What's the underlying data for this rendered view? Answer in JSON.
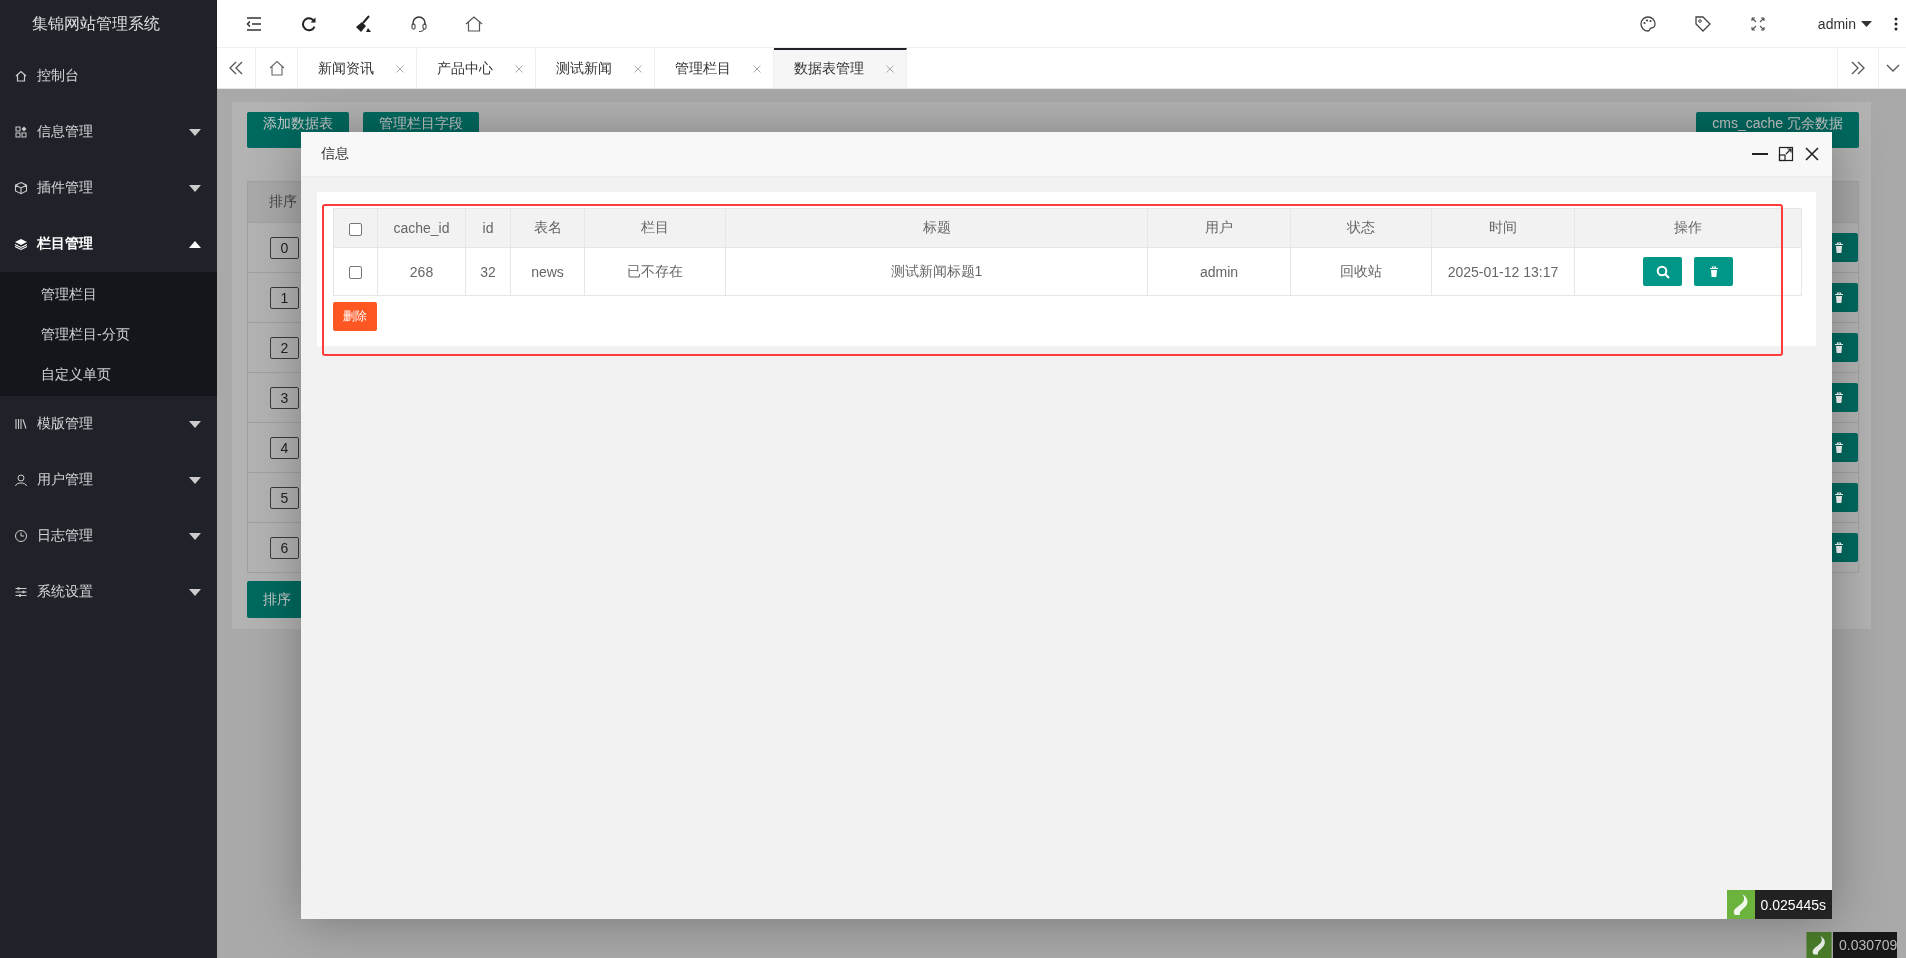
{
  "sidebar": {
    "title": "集锦网站管理系统",
    "items": [
      {
        "label": "控制台",
        "kind": "link"
      },
      {
        "label": "信息管理",
        "kind": "group",
        "expanded": false
      },
      {
        "label": "插件管理",
        "kind": "group",
        "expanded": false
      },
      {
        "label": "栏目管理",
        "kind": "group",
        "expanded": true,
        "children": [
          {
            "label": "管理栏目",
            "selected": false
          },
          {
            "label": "管理栏目-分页",
            "selected": false
          },
          {
            "label": "自定义单页",
            "selected": false
          }
        ]
      },
      {
        "label": "模版管理",
        "kind": "group",
        "expanded": false
      },
      {
        "label": "用户管理",
        "kind": "group",
        "expanded": false
      },
      {
        "label": "日志管理",
        "kind": "group",
        "expanded": false
      },
      {
        "label": "系统设置",
        "kind": "group",
        "expanded": false
      }
    ]
  },
  "header": {
    "user": "admin"
  },
  "tabs": [
    {
      "label": "新闻资讯",
      "selected": false
    },
    {
      "label": "产品中心",
      "selected": false
    },
    {
      "label": "测试新闻",
      "selected": false
    },
    {
      "label": "管理栏目",
      "selected": false
    },
    {
      "label": "数据表管理",
      "selected": true
    }
  ],
  "page": {
    "buttons": [
      "添加数据表",
      "管理栏目字段"
    ],
    "cache_button": "cms_cache 冗余数据",
    "table": {
      "columns": [
        "排序"
      ],
      "rows": [
        {
          "order": "0"
        },
        {
          "order": "1"
        },
        {
          "order": "2"
        },
        {
          "order": "3"
        },
        {
          "order": "4"
        },
        {
          "order": "5"
        },
        {
          "order": "6"
        }
      ]
    },
    "sort_button": "排序",
    "timer": "0.030709"
  },
  "dialog": {
    "title": "信息",
    "table": {
      "header_checked": false,
      "columns": [
        "cache_id",
        "id",
        "表名",
        "栏目",
        "标题",
        "用户",
        "状态",
        "时间",
        "操作"
      ],
      "rows": [
        {
          "checked": false,
          "cells": [
            "268",
            "32",
            "news",
            "已不存在",
            "测试新闻标题1",
            "admin",
            "回收站",
            "2025-01-12 13:17"
          ]
        }
      ]
    },
    "delete_button": "删除",
    "timer": "0.025445s"
  }
}
